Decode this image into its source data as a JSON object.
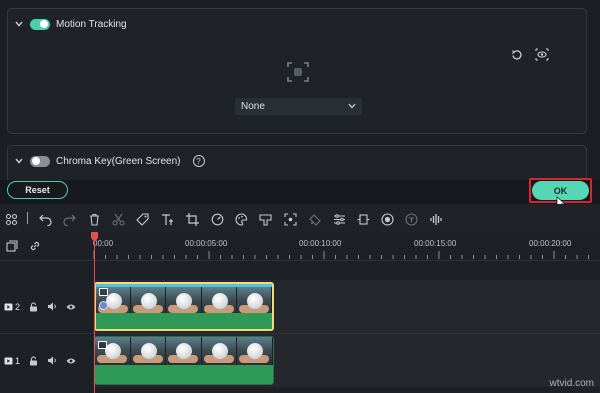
{
  "properties": {
    "motion_tracking": {
      "title": "Motion Tracking",
      "enabled": true,
      "select_value": "None"
    },
    "chroma_key": {
      "title": "Chroma Key(Green Screen)",
      "enabled": false,
      "help_label": "?"
    }
  },
  "actions": {
    "reset_label": "Reset",
    "ok_label": "OK"
  },
  "toolbar": {
    "tools": [
      "grid-icon",
      "undo-icon",
      "redo-icon",
      "delete-icon",
      "cut-icon",
      "tag-icon",
      "text-icon",
      "crop-icon",
      "speedometer-icon",
      "color-icon",
      "stamp-icon",
      "focus-icon",
      "motion-icon",
      "adjust-icon",
      "freeze-frame-icon",
      "ai-icon",
      "tts-icon",
      "audio-wave-icon"
    ]
  },
  "timeline": {
    "ruler_labels": [
      "00:00",
      "00:00:05:00",
      "00:00:10:00",
      "00:00:15:00",
      "00:00:20:00"
    ],
    "tracks": [
      {
        "number": "2"
      },
      {
        "number": "1"
      }
    ]
  },
  "watermark": "wtvid.com",
  "colors": {
    "accent": "#4ecdb0",
    "ok_highlight": "#d8262c",
    "playhead": "#e2514d",
    "selected_clip": "#f2da77",
    "audio": "#2f9a58"
  }
}
